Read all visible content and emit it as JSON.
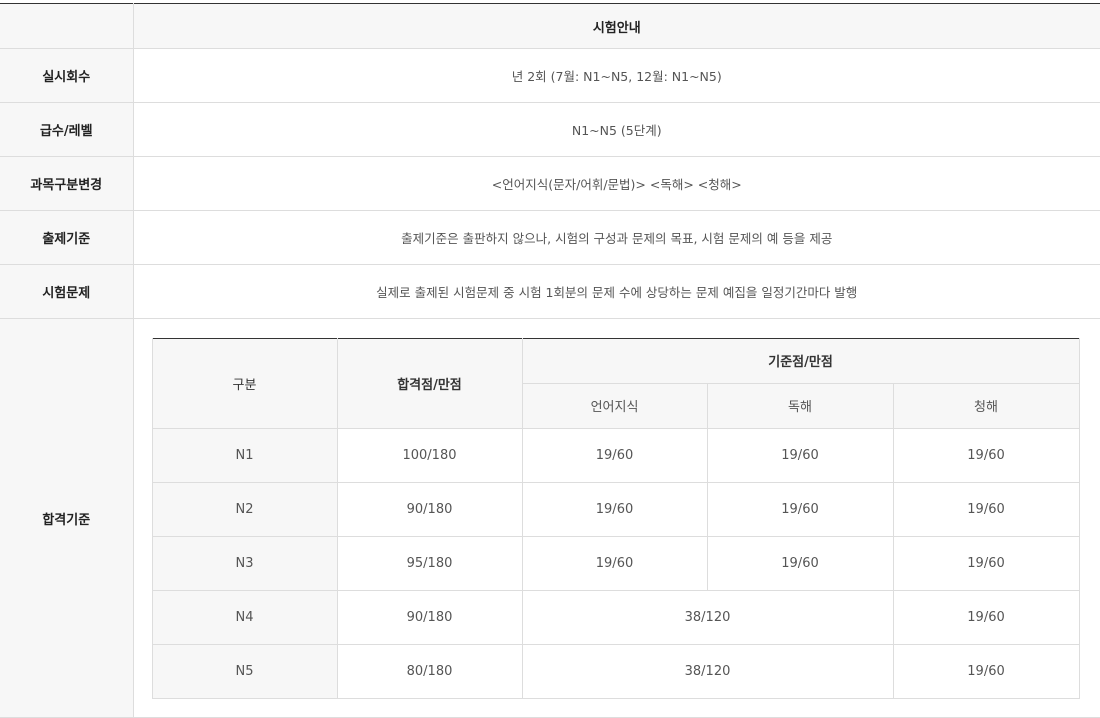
{
  "header": {
    "title": "시험안내"
  },
  "rows": [
    {
      "label": "실시회수",
      "value": "년 2회 (7월: N1~N5, 12월: N1~N5)"
    },
    {
      "label": "급수/레벨",
      "value": "N1~N5 (5단계)"
    },
    {
      "label": "과목구분변경",
      "value": "<언어지식(문자/어휘/문법)> <독해> <청해>"
    },
    {
      "label": "출제기준",
      "value": "출제기준은 출판하지 않으나, 시험의 구성과 문제의 목표, 시험 문제의 예 등을 제공"
    },
    {
      "label": "시험문제",
      "value": "실제로 출제된 시험문제 중 시험 1회분의 문제 수에 상당하는 문제 예집을 일정기간마다 발행"
    }
  ],
  "pass": {
    "label": "합격기준",
    "table": {
      "col_division": "구분",
      "col_pass": "합격점/만점",
      "col_base": "기준점/만점",
      "sub_language": "언어지식",
      "sub_reading": "독해",
      "sub_listening": "청해",
      "levels": [
        {
          "level": "N1",
          "pass": "100/180",
          "language": "19/60",
          "reading": "19/60",
          "listening": "19/60"
        },
        {
          "level": "N2",
          "pass": "90/180",
          "language": "19/60",
          "reading": "19/60",
          "listening": "19/60"
        },
        {
          "level": "N3",
          "pass": "95/180",
          "language": "19/60",
          "reading": "19/60",
          "listening": "19/60"
        },
        {
          "level": "N4",
          "pass": "90/180",
          "combined": "38/120",
          "listening": "19/60"
        },
        {
          "level": "N5",
          "pass": "80/180",
          "combined": "38/120",
          "listening": "19/60"
        }
      ]
    }
  }
}
